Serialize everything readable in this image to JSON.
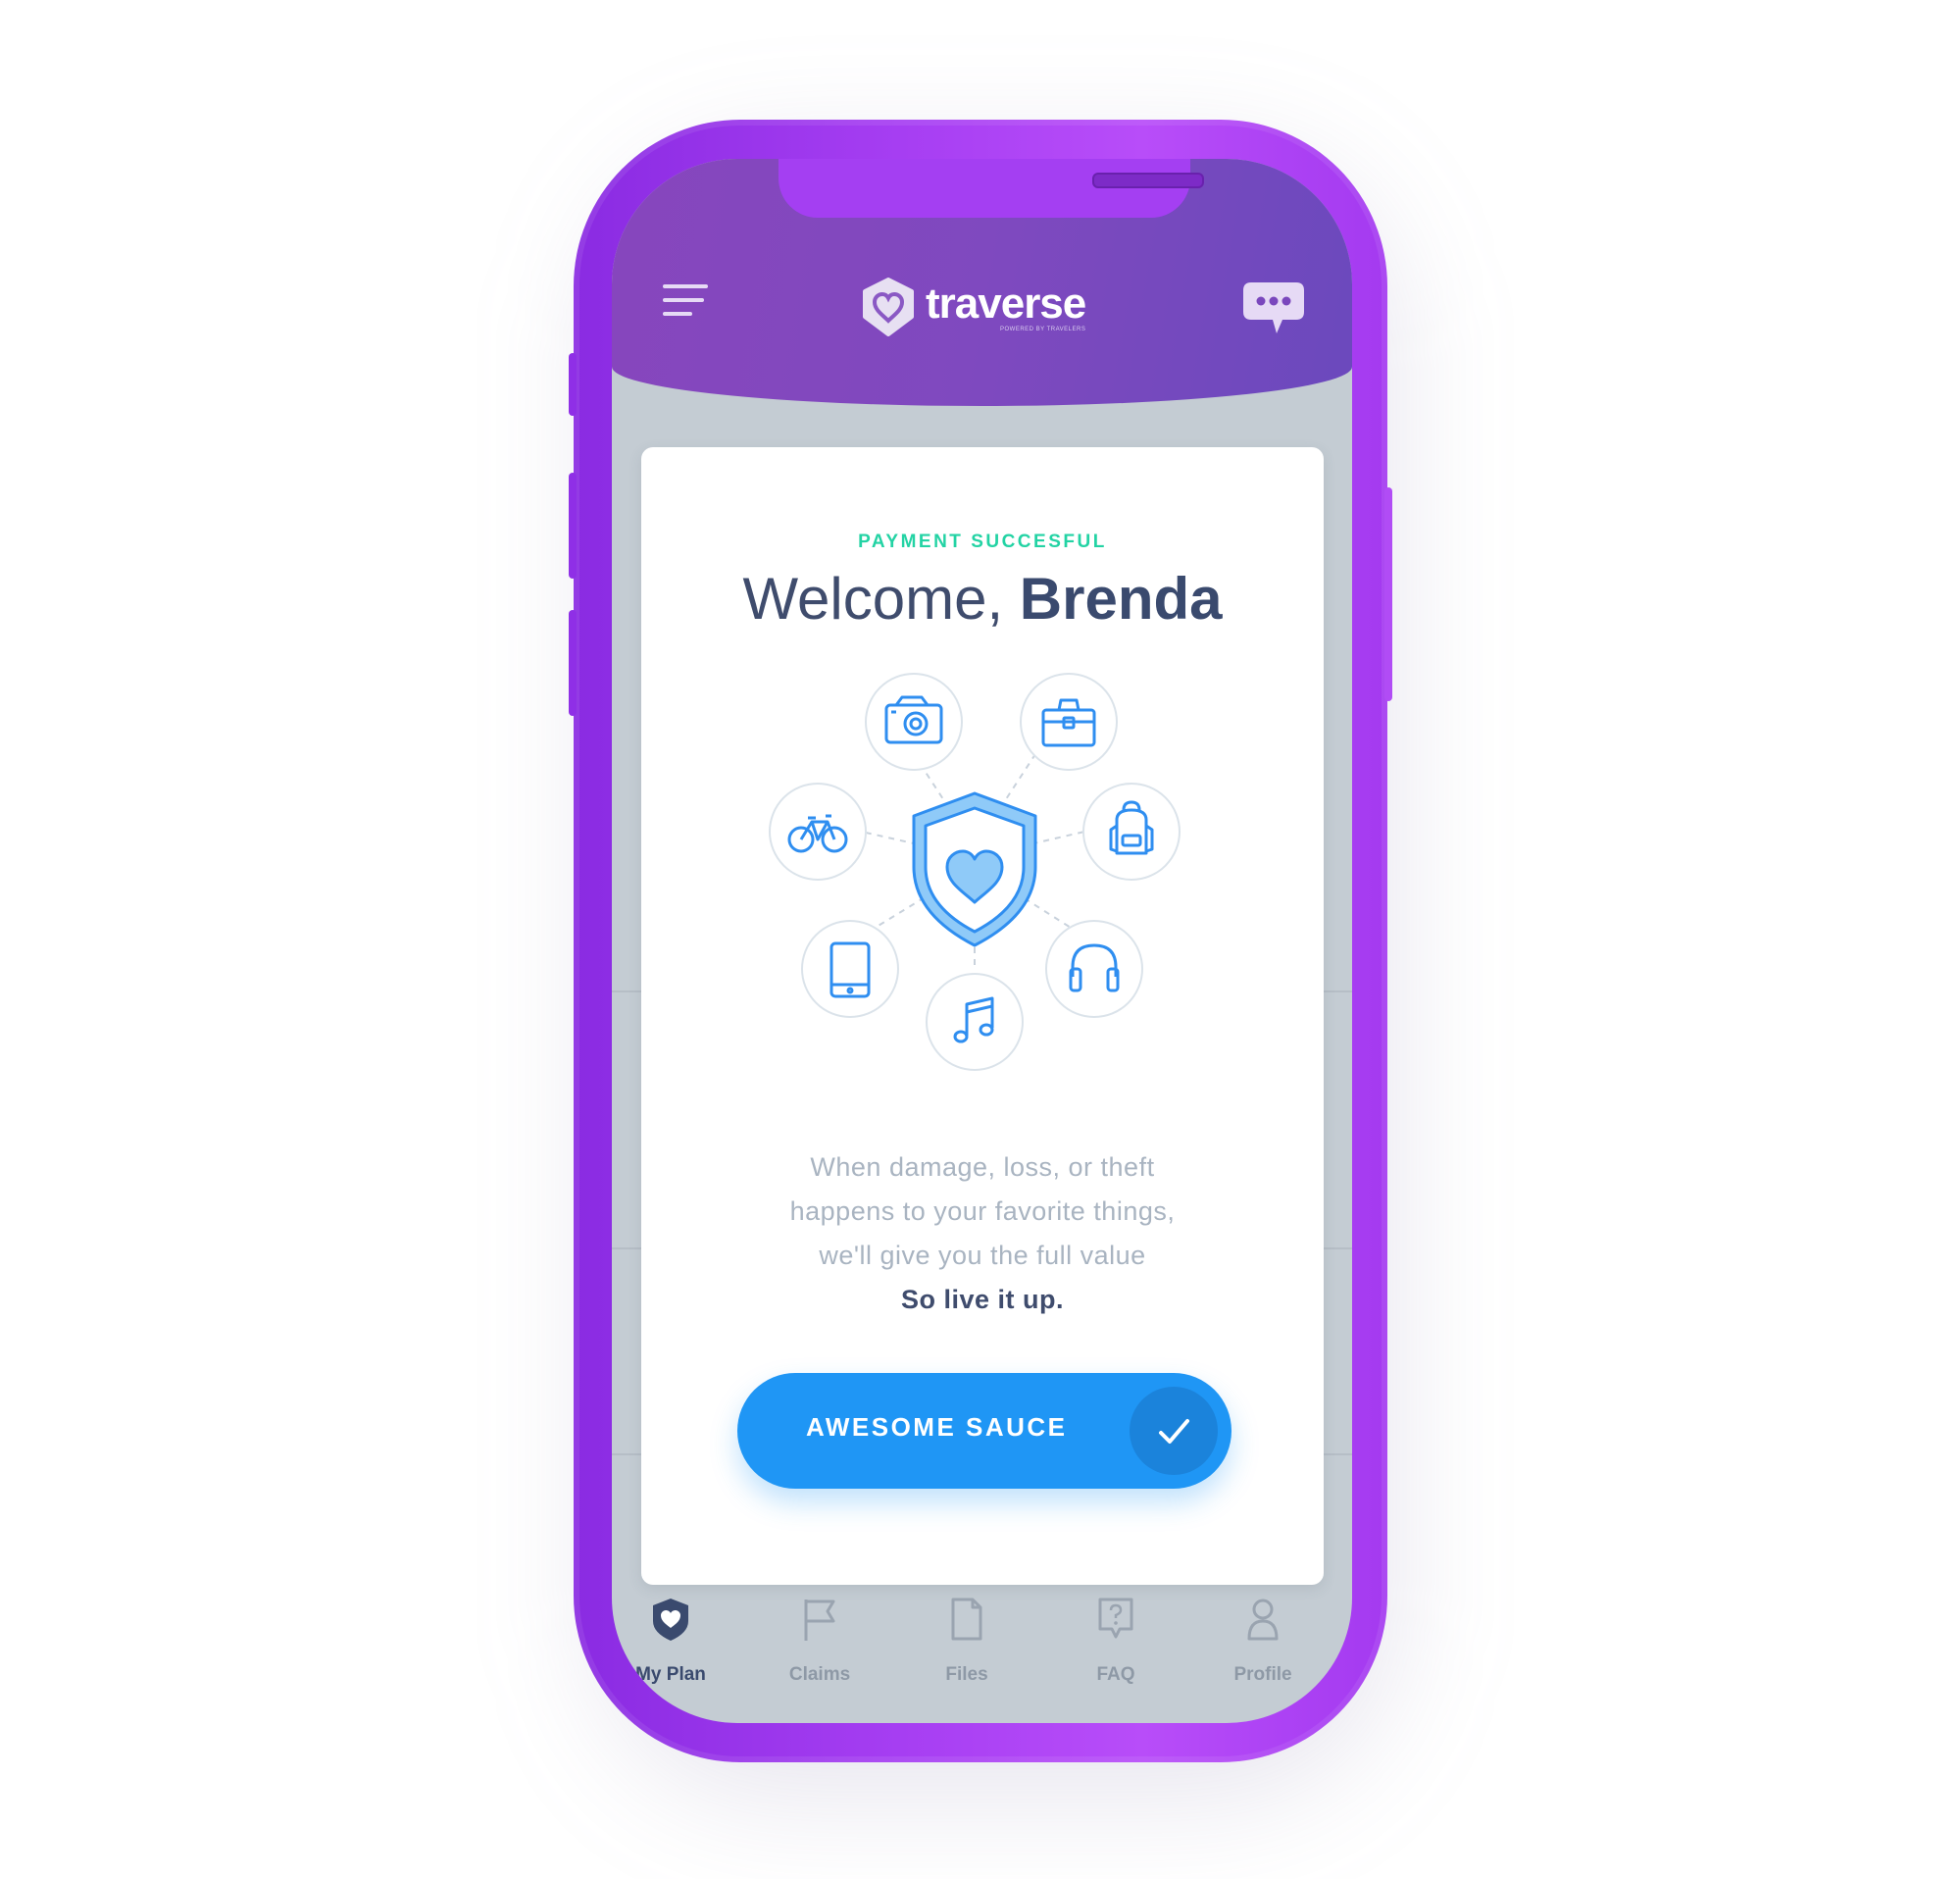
{
  "header": {
    "brand": "traverse",
    "brand_tagline": "POWERED BY TRAVELERS"
  },
  "card": {
    "eyebrow": "PAYMENT SUCCESFUL",
    "greeting": "Welcome,",
    "user_name": "Brenda",
    "description_lines": [
      "When damage, loss, or theft",
      "happens to your favorite things,",
      "we'll give you the full value"
    ],
    "tagline": "So live it up.",
    "cta_label": "AWESOME SAUCE"
  },
  "illustration": {
    "center_icon": "shield-heart-icon",
    "items": [
      "camera-icon",
      "briefcase-icon",
      "backpack-icon",
      "headphones-icon",
      "music-note-icon",
      "tablet-icon",
      "bicycle-icon"
    ]
  },
  "tabs": [
    {
      "label": "My Plan",
      "icon": "shield-heart-icon",
      "active": true
    },
    {
      "label": "Claims",
      "icon": "flag-icon",
      "active": false
    },
    {
      "label": "Files",
      "icon": "file-icon",
      "active": false
    },
    {
      "label": "FAQ",
      "icon": "question-bubble-icon",
      "active": false
    },
    {
      "label": "Profile",
      "icon": "person-icon",
      "active": false
    }
  ],
  "colors": {
    "phone": "#a63ef2",
    "header": "#7f49bf",
    "accent": "#1f96f5",
    "success": "#23d3a4",
    "heading": "#3f4c6d",
    "muted": "#a9b4c1"
  }
}
